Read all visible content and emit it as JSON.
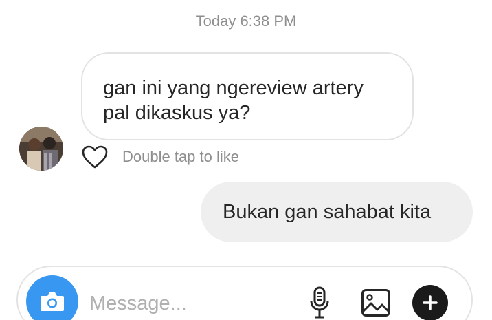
{
  "thread": {
    "timestamp": "Today 6:38 PM",
    "incoming_message": "gan ini yang ngereview artery pal dikaskus ya?",
    "like_hint": "Double tap to like",
    "outgoing_message": "Bukan gan sahabat kita"
  },
  "composer": {
    "placeholder": "Message...",
    "icons": [
      "camera-icon",
      "microphone-icon",
      "gallery-icon",
      "plus-icon"
    ]
  },
  "colors": {
    "accent": "#3897f0",
    "incoming_border": "#e3e3e3",
    "outgoing_bg": "#efefef",
    "muted_text": "#8e8e8e"
  }
}
